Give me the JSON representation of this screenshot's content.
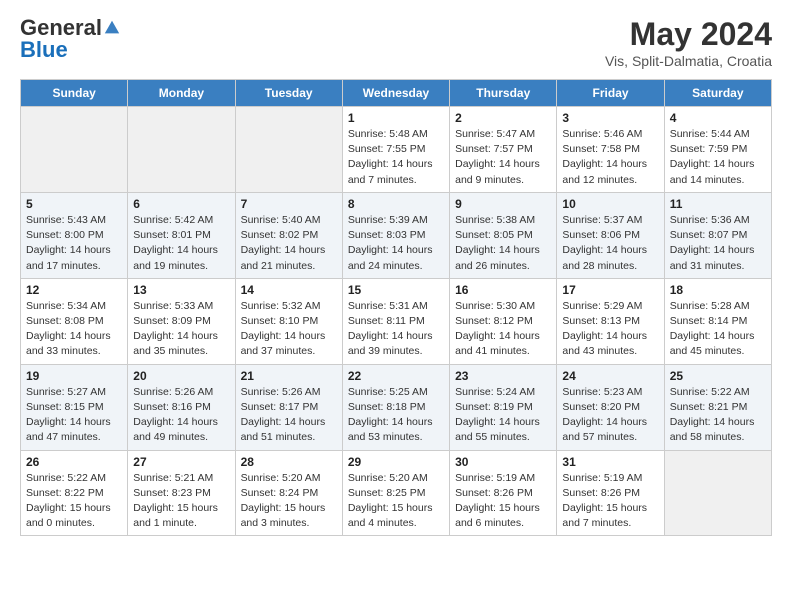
{
  "header": {
    "logo_general": "General",
    "logo_blue": "Blue",
    "main_title": "May 2024",
    "subtitle": "Vis, Split-Dalmatia, Croatia"
  },
  "calendar": {
    "days_of_week": [
      "Sunday",
      "Monday",
      "Tuesday",
      "Wednesday",
      "Thursday",
      "Friday",
      "Saturday"
    ],
    "weeks": [
      [
        {
          "day": "",
          "info": ""
        },
        {
          "day": "",
          "info": ""
        },
        {
          "day": "",
          "info": ""
        },
        {
          "day": "1",
          "info": "Sunrise: 5:48 AM\nSunset: 7:55 PM\nDaylight: 14 hours\nand 7 minutes."
        },
        {
          "day": "2",
          "info": "Sunrise: 5:47 AM\nSunset: 7:57 PM\nDaylight: 14 hours\nand 9 minutes."
        },
        {
          "day": "3",
          "info": "Sunrise: 5:46 AM\nSunset: 7:58 PM\nDaylight: 14 hours\nand 12 minutes."
        },
        {
          "day": "4",
          "info": "Sunrise: 5:44 AM\nSunset: 7:59 PM\nDaylight: 14 hours\nand 14 minutes."
        }
      ],
      [
        {
          "day": "5",
          "info": "Sunrise: 5:43 AM\nSunset: 8:00 PM\nDaylight: 14 hours\nand 17 minutes."
        },
        {
          "day": "6",
          "info": "Sunrise: 5:42 AM\nSunset: 8:01 PM\nDaylight: 14 hours\nand 19 minutes."
        },
        {
          "day": "7",
          "info": "Sunrise: 5:40 AM\nSunset: 8:02 PM\nDaylight: 14 hours\nand 21 minutes."
        },
        {
          "day": "8",
          "info": "Sunrise: 5:39 AM\nSunset: 8:03 PM\nDaylight: 14 hours\nand 24 minutes."
        },
        {
          "day": "9",
          "info": "Sunrise: 5:38 AM\nSunset: 8:05 PM\nDaylight: 14 hours\nand 26 minutes."
        },
        {
          "day": "10",
          "info": "Sunrise: 5:37 AM\nSunset: 8:06 PM\nDaylight: 14 hours\nand 28 minutes."
        },
        {
          "day": "11",
          "info": "Sunrise: 5:36 AM\nSunset: 8:07 PM\nDaylight: 14 hours\nand 31 minutes."
        }
      ],
      [
        {
          "day": "12",
          "info": "Sunrise: 5:34 AM\nSunset: 8:08 PM\nDaylight: 14 hours\nand 33 minutes."
        },
        {
          "day": "13",
          "info": "Sunrise: 5:33 AM\nSunset: 8:09 PM\nDaylight: 14 hours\nand 35 minutes."
        },
        {
          "day": "14",
          "info": "Sunrise: 5:32 AM\nSunset: 8:10 PM\nDaylight: 14 hours\nand 37 minutes."
        },
        {
          "day": "15",
          "info": "Sunrise: 5:31 AM\nSunset: 8:11 PM\nDaylight: 14 hours\nand 39 minutes."
        },
        {
          "day": "16",
          "info": "Sunrise: 5:30 AM\nSunset: 8:12 PM\nDaylight: 14 hours\nand 41 minutes."
        },
        {
          "day": "17",
          "info": "Sunrise: 5:29 AM\nSunset: 8:13 PM\nDaylight: 14 hours\nand 43 minutes."
        },
        {
          "day": "18",
          "info": "Sunrise: 5:28 AM\nSunset: 8:14 PM\nDaylight: 14 hours\nand 45 minutes."
        }
      ],
      [
        {
          "day": "19",
          "info": "Sunrise: 5:27 AM\nSunset: 8:15 PM\nDaylight: 14 hours\nand 47 minutes."
        },
        {
          "day": "20",
          "info": "Sunrise: 5:26 AM\nSunset: 8:16 PM\nDaylight: 14 hours\nand 49 minutes."
        },
        {
          "day": "21",
          "info": "Sunrise: 5:26 AM\nSunset: 8:17 PM\nDaylight: 14 hours\nand 51 minutes."
        },
        {
          "day": "22",
          "info": "Sunrise: 5:25 AM\nSunset: 8:18 PM\nDaylight: 14 hours\nand 53 minutes."
        },
        {
          "day": "23",
          "info": "Sunrise: 5:24 AM\nSunset: 8:19 PM\nDaylight: 14 hours\nand 55 minutes."
        },
        {
          "day": "24",
          "info": "Sunrise: 5:23 AM\nSunset: 8:20 PM\nDaylight: 14 hours\nand 57 minutes."
        },
        {
          "day": "25",
          "info": "Sunrise: 5:22 AM\nSunset: 8:21 PM\nDaylight: 14 hours\nand 58 minutes."
        }
      ],
      [
        {
          "day": "26",
          "info": "Sunrise: 5:22 AM\nSunset: 8:22 PM\nDaylight: 15 hours\nand 0 minutes."
        },
        {
          "day": "27",
          "info": "Sunrise: 5:21 AM\nSunset: 8:23 PM\nDaylight: 15 hours\nand 1 minute."
        },
        {
          "day": "28",
          "info": "Sunrise: 5:20 AM\nSunset: 8:24 PM\nDaylight: 15 hours\nand 3 minutes."
        },
        {
          "day": "29",
          "info": "Sunrise: 5:20 AM\nSunset: 8:25 PM\nDaylight: 15 hours\nand 4 minutes."
        },
        {
          "day": "30",
          "info": "Sunrise: 5:19 AM\nSunset: 8:26 PM\nDaylight: 15 hours\nand 6 minutes."
        },
        {
          "day": "31",
          "info": "Sunrise: 5:19 AM\nSunset: 8:26 PM\nDaylight: 15 hours\nand 7 minutes."
        },
        {
          "day": "",
          "info": ""
        }
      ]
    ]
  }
}
